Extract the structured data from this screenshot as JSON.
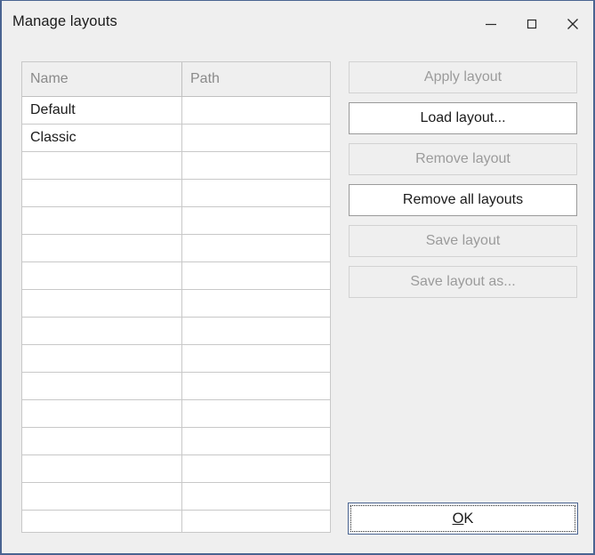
{
  "window": {
    "title": "Manage layouts",
    "border_color": "#4a6491",
    "background": "#efefef",
    "controls": [
      {
        "name": "minimize",
        "glyph": "minimize-icon"
      },
      {
        "name": "maximize",
        "glyph": "maximize-icon"
      },
      {
        "name": "close",
        "glyph": "close-icon"
      }
    ]
  },
  "table": {
    "columns": [
      {
        "key": "name",
        "label": "Name"
      },
      {
        "key": "path",
        "label": "Path"
      }
    ],
    "rows": [
      {
        "name": "Default",
        "path": ""
      },
      {
        "name": "Classic",
        "path": ""
      },
      {
        "name": "",
        "path": ""
      },
      {
        "name": "",
        "path": ""
      },
      {
        "name": "",
        "path": ""
      },
      {
        "name": "",
        "path": ""
      },
      {
        "name": "",
        "path": ""
      },
      {
        "name": "",
        "path": ""
      },
      {
        "name": "",
        "path": ""
      },
      {
        "name": "",
        "path": ""
      },
      {
        "name": "",
        "path": ""
      },
      {
        "name": "",
        "path": ""
      },
      {
        "name": "",
        "path": ""
      },
      {
        "name": "",
        "path": ""
      },
      {
        "name": "",
        "path": ""
      },
      {
        "name": "",
        "path": ""
      }
    ]
  },
  "buttons": [
    {
      "id": "apply-layout",
      "label": "Apply layout",
      "enabled": false
    },
    {
      "id": "load-layout",
      "label": "Load layout...",
      "enabled": true
    },
    {
      "id": "remove-layout",
      "label": "Remove layout",
      "enabled": false
    },
    {
      "id": "remove-all-layouts",
      "label": "Remove all layouts",
      "enabled": true
    },
    {
      "id": "save-layout",
      "label": "Save layout",
      "enabled": false
    },
    {
      "id": "save-layout-as",
      "label": "Save layout as...",
      "enabled": false
    }
  ],
  "ok_button": {
    "mnemonic": "O",
    "rest": "K",
    "focused": true
  }
}
